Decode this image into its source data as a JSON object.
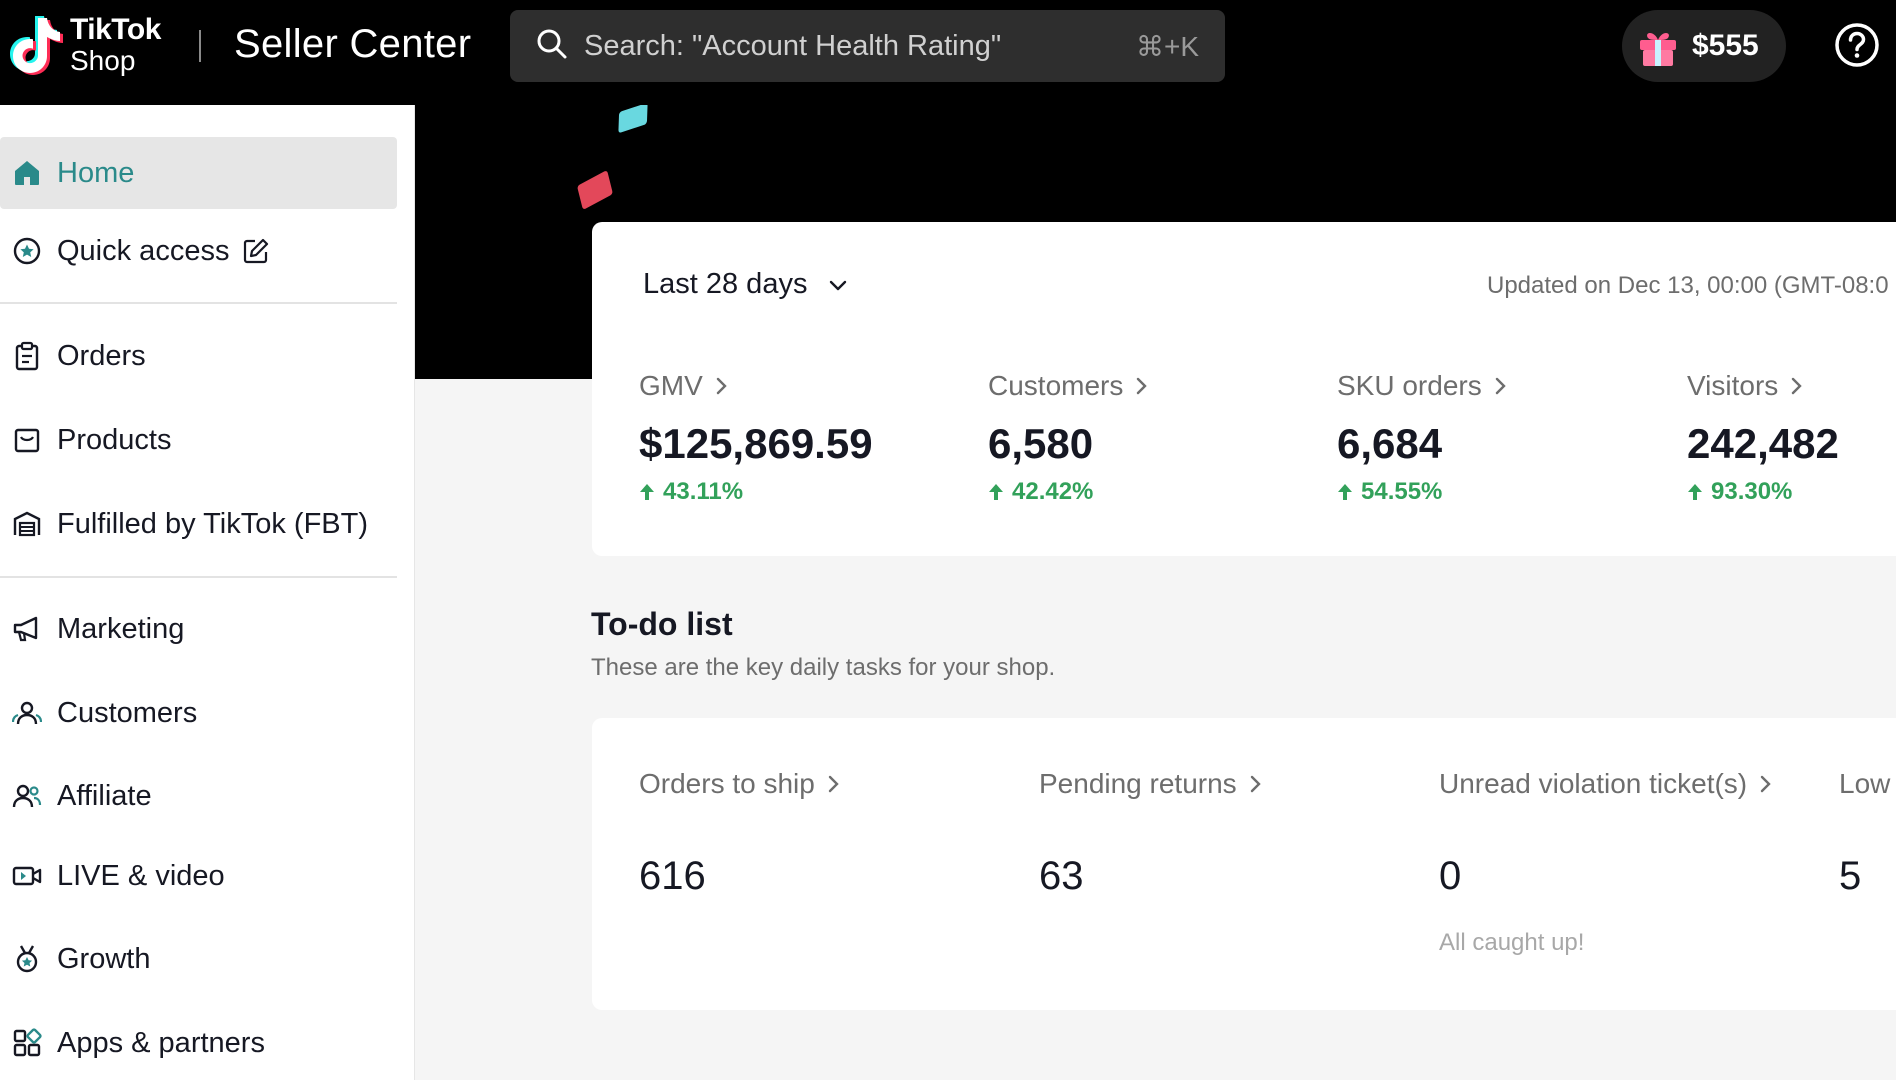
{
  "header": {
    "logo_line1": "TikTok",
    "logo_line2": "Shop",
    "title": "Seller Center",
    "search_placeholder": "Search: \"Account Health Rating\"",
    "search_shortcut": "⌘+K",
    "reward_amount": "$555",
    "icons": {
      "search": "search-icon",
      "gift": "gift-icon",
      "help": "help-circle-icon"
    }
  },
  "sidebar": {
    "items": [
      {
        "label": "Home",
        "icon": "home-icon",
        "active": true
      },
      {
        "label": "Quick access",
        "icon": "star-circle-icon"
      },
      {
        "label": "Orders",
        "icon": "clipboard-icon"
      },
      {
        "label": "Products",
        "icon": "box-icon"
      },
      {
        "label": "Fulfilled by TikTok (FBT)",
        "icon": "warehouse-icon"
      },
      {
        "label": "Marketing",
        "icon": "megaphone-icon"
      },
      {
        "label": "Customers",
        "icon": "customers-icon"
      },
      {
        "label": "Affiliate",
        "icon": "affiliate-icon"
      },
      {
        "label": "LIVE & video",
        "icon": "video-icon"
      },
      {
        "label": "Growth",
        "icon": "medal-icon"
      },
      {
        "label": "Apps & partners",
        "icon": "apps-grid-icon"
      }
    ]
  },
  "stats": {
    "range": "Last 28 days",
    "updated": "Updated on Dec 13, 00:00 (GMT-08:0",
    "metrics": [
      {
        "label": "GMV",
        "value": "$125,869.59",
        "change": "43.11%"
      },
      {
        "label": "Customers",
        "value": "6,580",
        "change": "42.42%"
      },
      {
        "label": "SKU orders",
        "value": "6,684",
        "change": "54.55%"
      },
      {
        "label": "Visitors",
        "value": "242,482",
        "change": "93.30%"
      }
    ]
  },
  "todo": {
    "title": "To-do list",
    "subtitle": "These are the key daily tasks for your shop.",
    "tasks": [
      {
        "label": "Orders to ship",
        "value": "616",
        "note": ""
      },
      {
        "label": "Pending returns",
        "value": "63",
        "note": ""
      },
      {
        "label": "Unread violation ticket(s)",
        "value": "0",
        "note": "All caught up!"
      },
      {
        "label": "Low",
        "value": "5",
        "note": ""
      }
    ]
  },
  "colors": {
    "accent_teal": "#2a8a8a",
    "positive_green": "#32a15a",
    "topbar_bg": "#000000",
    "confetti_cyan": "#69d8e0",
    "confetti_red": "#e3485a"
  }
}
